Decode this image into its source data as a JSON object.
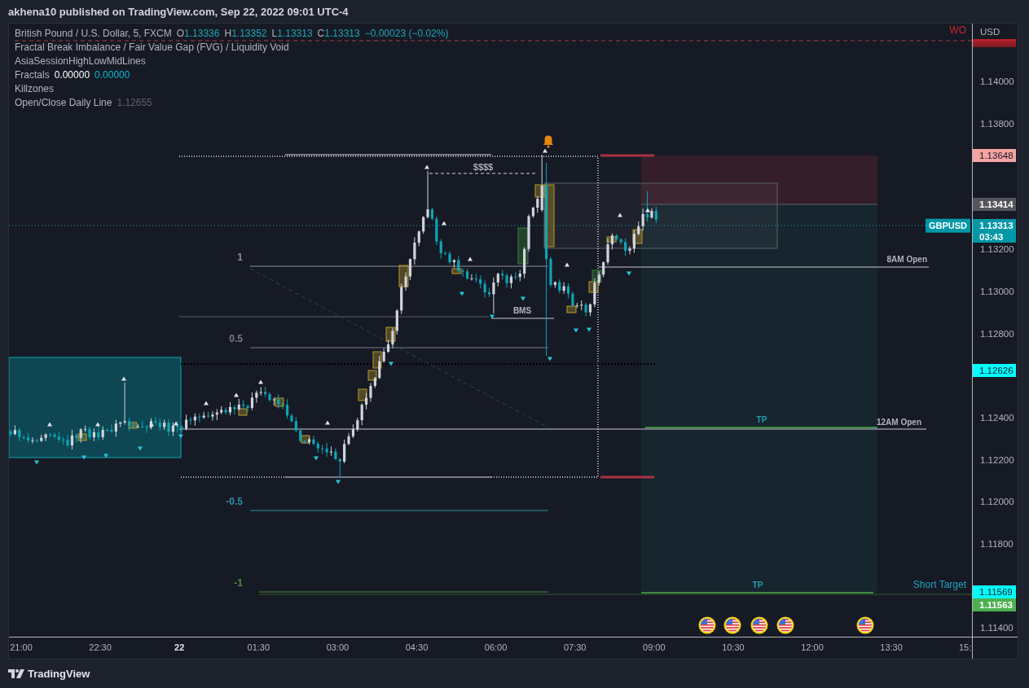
{
  "header": {
    "title": "akhena10 published on TradingView.com, Sep 22, 2022 09:01 UTC-4"
  },
  "legend": {
    "symbol": "British Pound / U.S. Dollar, 5, FXCM",
    "ohlc": [
      {
        "key": "O",
        "value": "1.13336"
      },
      {
        "key": "H",
        "value": "1.13352"
      },
      {
        "key": "L",
        "value": "1.13313"
      },
      {
        "key": "C",
        "value": "1.13313"
      }
    ],
    "change": "−0.00023 (−0.02%)",
    "indicators": [
      {
        "name": "Fractal Break Imbalance / Fair Value Gap (FVG) / Liquidity Void"
      },
      {
        "name": "AsiaSessionHighLowMidLines"
      },
      {
        "name": "Fractals",
        "values": [
          {
            "text": "0.00000",
            "color": "#ffffff"
          },
          {
            "text": "0.00000",
            "color": "#00bcd4"
          }
        ]
      },
      {
        "name": "Killzones"
      },
      {
        "name": "Open/Close Daily Line",
        "values": [
          {
            "text": "1.12655",
            "color": "#5e616c"
          }
        ]
      }
    ]
  },
  "chart": {
    "fib_levels": [
      {
        "label": "1",
        "color": "#8c8f99"
      },
      {
        "label": "0.5",
        "color": "#787b86"
      },
      {
        "label": "-0.5",
        "color": "#2e8ea3"
      },
      {
        "label": "-1",
        "color": "#4c8a3c"
      }
    ],
    "annotations": [
      {
        "text": "WO",
        "color": "#c8282f"
      },
      {
        "text": "$$$$",
        "color": "#d1d4dc"
      },
      {
        "text": "8AM Open",
        "color": "#b2b5be"
      },
      {
        "text": "BMS",
        "color": "#b2b5be"
      },
      {
        "text": "TP",
        "color": "#1e9fb3"
      },
      {
        "text": "12AM Open",
        "color": "#b2b5be"
      },
      {
        "text": "TP",
        "color": "#1e9fb3"
      },
      {
        "text": "Short Target",
        "color": "#1ea5c2"
      }
    ],
    "symbol_tag": "GBPUSD"
  },
  "price_axis": {
    "unit": "USD",
    "ticks": [
      "1.14000",
      "1.13800",
      "1.13200",
      "1.13000",
      "1.12800",
      "1.12400",
      "1.12200",
      "1.12000",
      "1.11800",
      "1.11400"
    ],
    "markers": [
      {
        "text": "1.13648",
        "color": "#f4a3a3"
      },
      {
        "text": "1.13414",
        "color": "#55565c"
      },
      {
        "text": "1.13313",
        "countdown": "03:43",
        "color": "#0097a7"
      },
      {
        "text": "1.12626",
        "color": "#00ffff"
      },
      {
        "text": "1.11569",
        "color": "#00ffff"
      },
      {
        "text": "1.11563",
        "color": "#4caf50"
      }
    ]
  },
  "time_axis": {
    "ticks": [
      {
        "label": "21:00",
        "kind": "time"
      },
      {
        "label": "22:30",
        "kind": "time"
      },
      {
        "label": "22",
        "kind": "day"
      },
      {
        "label": "01:30",
        "kind": "time"
      },
      {
        "label": "03:00",
        "kind": "time"
      },
      {
        "label": "04:30",
        "kind": "time"
      },
      {
        "label": "06:00",
        "kind": "time"
      },
      {
        "label": "07:30",
        "kind": "time"
      },
      {
        "label": "09:00",
        "kind": "time"
      },
      {
        "label": "10:30",
        "kind": "time"
      },
      {
        "label": "12:00",
        "kind": "time"
      },
      {
        "label": "13:30",
        "kind": "time"
      },
      {
        "label": "15:",
        "kind": "time"
      }
    ]
  },
  "footer": {
    "brand": "TradingView"
  }
}
